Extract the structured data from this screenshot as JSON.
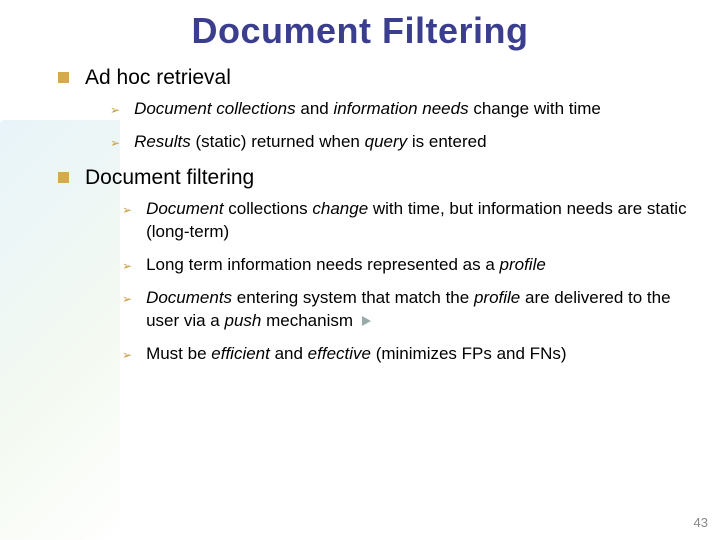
{
  "title": "Document Filtering",
  "sections": [
    {
      "heading": "Ad hoc retrieval",
      "items": [
        {
          "segments": [
            {
              "t": "Document collections",
              "i": true
            },
            {
              "t": " and ",
              "i": false
            },
            {
              "t": "information needs",
              "i": true
            },
            {
              "t": " change with time",
              "i": false
            }
          ]
        },
        {
          "segments": [
            {
              "t": "Results",
              "i": true
            },
            {
              "t": " (static) returned when ",
              "i": false
            },
            {
              "t": "query",
              "i": true
            },
            {
              "t": " is entered",
              "i": false
            }
          ]
        }
      ]
    },
    {
      "heading": "Document filtering",
      "items": [
        {
          "segments": [
            {
              "t": "Document",
              "i": true
            },
            {
              "t": " collections ",
              "i": false
            },
            {
              "t": "change",
              "i": true
            },
            {
              "t": " with time, but information needs are static (long-term)",
              "i": false
            }
          ]
        },
        {
          "segments": [
            {
              "t": "Long term information needs represented as a ",
              "i": false
            },
            {
              "t": "profile",
              "i": true
            }
          ]
        },
        {
          "segments": [
            {
              "t": "Documents",
              "i": true
            },
            {
              "t": " entering system that match the ",
              "i": false
            },
            {
              "t": "profile",
              "i": true
            },
            {
              "t": " are delivered to the user via a ",
              "i": false
            },
            {
              "t": "push",
              "i": true
            },
            {
              "t": " mechanism",
              "i": false
            }
          ],
          "trailingIcon": true
        },
        {
          "segments": [
            {
              "t": "Must be ",
              "i": false
            },
            {
              "t": "efficient",
              "i": true
            },
            {
              "t": " and ",
              "i": false
            },
            {
              "t": "effective",
              "i": true
            },
            {
              "t": " (minimizes FPs and FNs)",
              "i": false
            }
          ]
        }
      ]
    }
  ],
  "pageNumber": "43"
}
